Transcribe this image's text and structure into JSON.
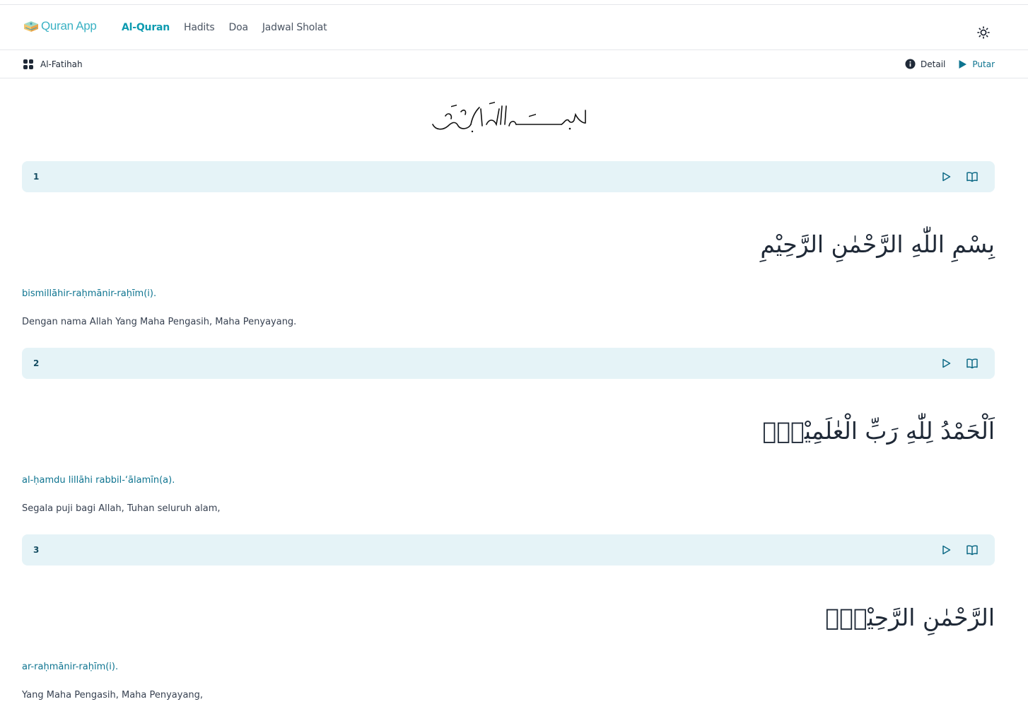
{
  "brand": {
    "name": "Quran App",
    "logo_icon": "quran-book-icon"
  },
  "nav": {
    "links": [
      {
        "label": "Al-Quran",
        "active": true
      },
      {
        "label": "Hadits",
        "active": false
      },
      {
        "label": "Doa",
        "active": false
      },
      {
        "label": "Jadwal Sholat",
        "active": false
      }
    ],
    "theme_icon": "sun-icon"
  },
  "subbar": {
    "surah_name": "Al-Fatihah",
    "surah_icon": "grid-icon",
    "detail_label": "Detail",
    "detail_icon": "info-icon",
    "play_label": "Putar",
    "play_icon": "play-icon"
  },
  "colors": {
    "accent": "#0e9bb0",
    "latin": "#0e7490",
    "verse_header_bg": "#e5f3f7",
    "verse_number": "#164e63"
  },
  "verses": [
    {
      "number": "1",
      "arabic": "بِسْمِ اللّٰهِ الرَّحْمٰنِ الرَّحِيْمِ",
      "latin": "bismillāhir-raḥmānir-raḥīm(i).",
      "translation": "Dengan nama Allah Yang Maha Pengasih, Maha Penyayang."
    },
    {
      "number": "2",
      "arabic": "اَلْحَمْدُ لِلّٰهِ رَبِّ الْعٰلَمِيْنَۙ",
      "latin": "al-ḥamdu lillāhi rabbil-‘ālamīn(a).",
      "translation": "Segala puji bagi Allah, Tuhan seluruh alam,"
    },
    {
      "number": "3",
      "arabic": "الرَّحْمٰنِ الرَّحِيْمِۙ",
      "latin": "ar-raḥmānir-raḥīm(i).",
      "translation": "Yang Maha Pengasih, Maha Penyayang,"
    }
  ]
}
